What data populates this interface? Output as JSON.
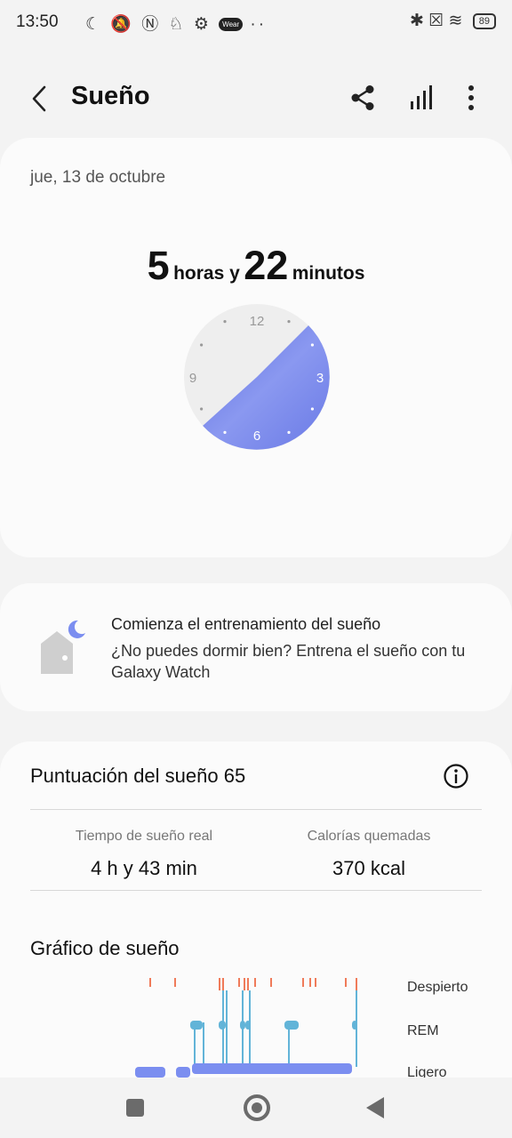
{
  "status_bar": {
    "time": "13:50",
    "left_icons": "☾ 🔕 Ⓝ ♘ ⚙",
    "wear_badge": "Wear",
    "dots": "··",
    "right_icons": "✱ ☒ ≋",
    "battery": "89"
  },
  "app_bar": {
    "title": "Sueño"
  },
  "sleep_summary": {
    "date": "jue, 13 de octubre",
    "hours": "5",
    "hours_unit": "horas y",
    "minutes": "22",
    "minutes_unit": "minutos",
    "clock": {
      "labels": {
        "n12": "12",
        "n3": "3",
        "n6": "6",
        "n9": "9"
      },
      "sleep_start_hour": 1.5,
      "sleep_end_hour": 7.6,
      "arc_color": "#6f7fe6",
      "face_color": "#eeeeee"
    }
  },
  "training": {
    "title": "Comienza el entrenamiento del sueño",
    "description": "¿No puedes dormir bien? Entrena el sueño con tu Galaxy Watch"
  },
  "score": {
    "title": "Puntuación del sueño 65",
    "real_sleep_label": "Tiempo de sueño real",
    "real_sleep_value": "4 h y 43 min",
    "calories_label": "Calorías quemadas",
    "calories_value": "370 kcal"
  },
  "chart": {
    "title": "Gráfico de sueño",
    "legend": {
      "awake": "Despierto",
      "rem": "REM",
      "light": "Ligero"
    },
    "colors": {
      "awake": "#ef7b5a",
      "rem": "#62b4d8",
      "light": "#7b8ef0"
    }
  }
}
